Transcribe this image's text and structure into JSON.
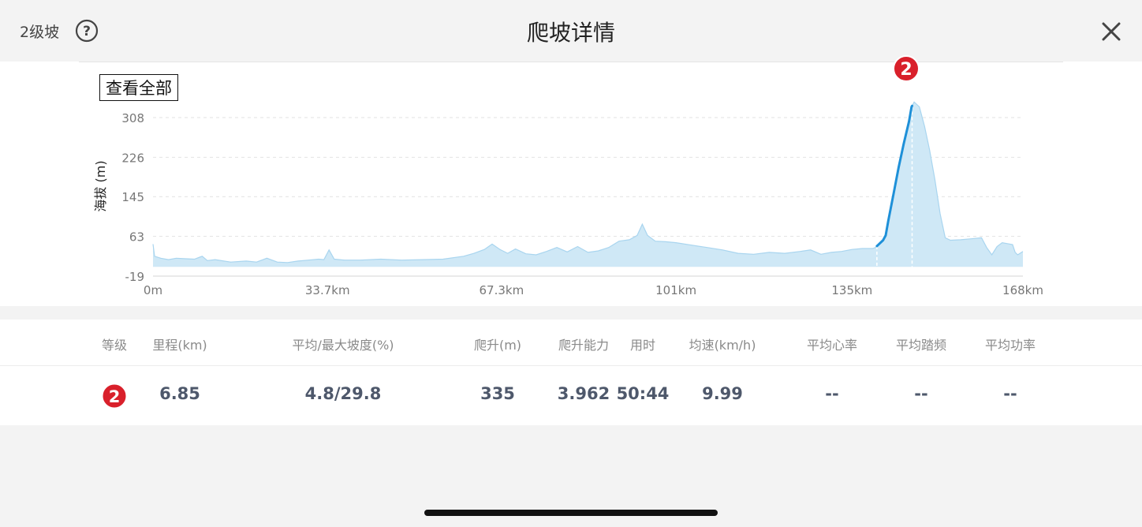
{
  "header": {
    "grade_label": "2级坡",
    "title": "爬坡详情"
  },
  "icons": {
    "help": "help-icon",
    "close": "close-icon",
    "grade_badge": "grade-2-badge"
  },
  "chart": {
    "view_all_label": "查看全部",
    "marker_label": "2"
  },
  "table": {
    "headers": [
      "等级",
      "里程(km)",
      "平均/最大坡度(%)",
      "爬升(m)",
      "爬升能力",
      "用时",
      "均速(km/h)",
      "平均心率",
      "平均踏频",
      "平均功率"
    ],
    "row": {
      "grade": "2",
      "distance": "6.85",
      "grade_avg_max": "4.8/29.8",
      "climb": "335",
      "climb_ability": "3.962",
      "time": "50:44",
      "avg_speed": "9.99",
      "avg_hr": "--",
      "avg_cadence": "--",
      "avg_power": "--"
    }
  },
  "colors": {
    "area_fill": "#cfe8f6",
    "area_stroke": "#a9d5ef",
    "climb_line": "#1e90d8",
    "badge_red": "#d9202b",
    "value_text": "#4e586b"
  },
  "chart_data": {
    "type": "area",
    "ylabel": "海拔 (m)",
    "xlabel": "",
    "title": "",
    "x_ticks": [
      "0m",
      "33.7km",
      "67.3km",
      "101km",
      "135km",
      "168km"
    ],
    "x_tick_values": [
      0,
      33.7,
      67.3,
      101,
      135,
      168
    ],
    "y_ticks": [
      "308",
      "226",
      "145",
      "63",
      "-19"
    ],
    "y_tick_values": [
      308,
      226,
      145,
      63,
      -19
    ],
    "xlim": [
      0,
      168
    ],
    "ylim": [
      -19,
      308
    ],
    "grid": true,
    "series": [
      {
        "x": [
          0,
          0.3,
          1.5,
          3,
          4.5,
          6,
          8,
          9.5,
          10.5,
          12,
          15,
          18,
          20,
          22,
          24,
          26,
          28,
          30,
          32,
          33,
          34,
          35,
          37,
          40,
          44,
          48,
          52,
          56,
          60,
          62,
          64,
          65.5,
          67,
          68.5,
          70,
          72,
          74,
          76,
          78,
          80,
          82,
          84,
          86,
          88,
          90,
          92,
          93.5,
          94.5,
          95.5,
          97,
          99,
          101,
          104,
          107,
          110,
          113,
          116,
          119,
          122,
          125,
          127,
          129,
          131,
          133,
          135,
          137,
          139,
          139.5,
          140,
          141,
          141.5,
          142,
          143,
          144,
          145,
          146,
          146.5,
          147,
          148,
          149,
          150,
          151,
          152,
          153,
          154,
          156,
          158,
          160,
          161,
          162,
          163,
          164,
          165,
          166,
          166.5,
          167,
          168
        ],
        "y": [
          47,
          22,
          18,
          15,
          18,
          17,
          16,
          22,
          13,
          15,
          10,
          12,
          10,
          18,
          10,
          9,
          12,
          14,
          16,
          15,
          35,
          16,
          14,
          14,
          16,
          14,
          15,
          16,
          22,
          28,
          36,
          47,
          36,
          28,
          37,
          27,
          25,
          32,
          40,
          31,
          42,
          30,
          33,
          40,
          53,
          56,
          65,
          88,
          65,
          53,
          52,
          50,
          45,
          40,
          35,
          28,
          26,
          30,
          28,
          32,
          35,
          26,
          30,
          32,
          36,
          38,
          38,
          40,
          45,
          55,
          65,
          95,
          150,
          205,
          255,
          300,
          330,
          340,
          330,
          290,
          240,
          180,
          110,
          60,
          55,
          56,
          58,
          60,
          40,
          25,
          42,
          50,
          48,
          46,
          30,
          25,
          32
        ],
        "highlight_range": [
          139.8,
          146.6
        ]
      }
    ]
  }
}
